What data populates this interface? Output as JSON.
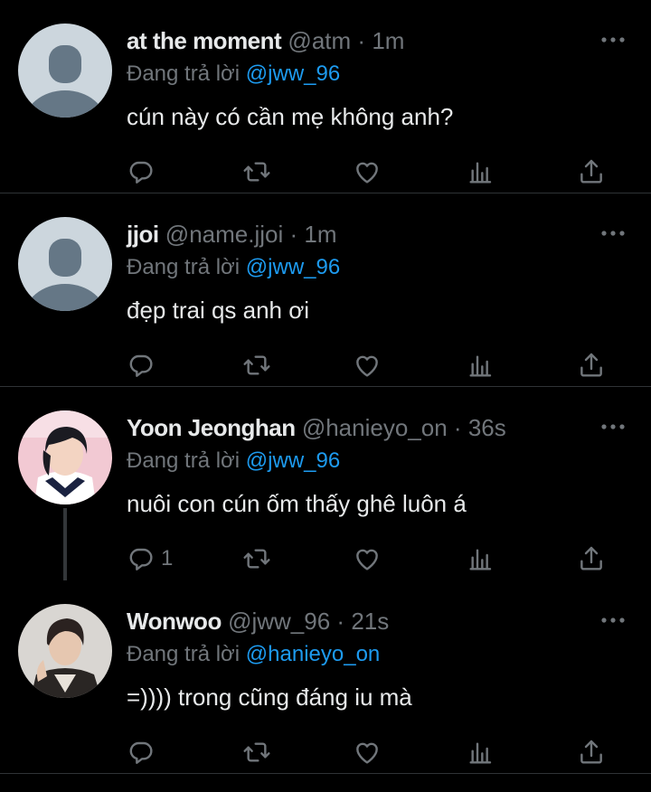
{
  "reply_prefix": "Đang trả lời",
  "tweets": [
    {
      "name": "at the moment",
      "handle": "@atm",
      "sep": "·",
      "time": "1m",
      "reply_to": "@jww_96",
      "text": "cún này có cần mẹ không anh?",
      "reply_count": ""
    },
    {
      "name": "jjoi",
      "handle": "@name.jjoi",
      "sep": "·",
      "time": "1m",
      "reply_to": "@jww_96",
      "text": "đẹp trai qs anh ơi",
      "reply_count": ""
    },
    {
      "name": "Yoon Jeonghan",
      "handle": "@hanieyo_on",
      "sep": "·",
      "time": "36s",
      "reply_to": "@jww_96",
      "text": "nuôi con cún ốm thấy ghê luôn á",
      "reply_count": "1"
    },
    {
      "name": "Wonwoo",
      "handle": "@jww_96",
      "sep": "·",
      "time": "21s",
      "reply_to": "@hanieyo_on",
      "text": "=)))) trong cũng đáng iu mà",
      "reply_count": ""
    }
  ],
  "colors": {
    "background": "#000000",
    "text": "#e7e9ea",
    "muted": "#71767b",
    "mention": "#1d9bf0",
    "divider": "#2f3336"
  },
  "icons": [
    "reply-icon",
    "retweet-icon",
    "like-icon",
    "views-icon",
    "share-icon",
    "more-icon"
  ]
}
